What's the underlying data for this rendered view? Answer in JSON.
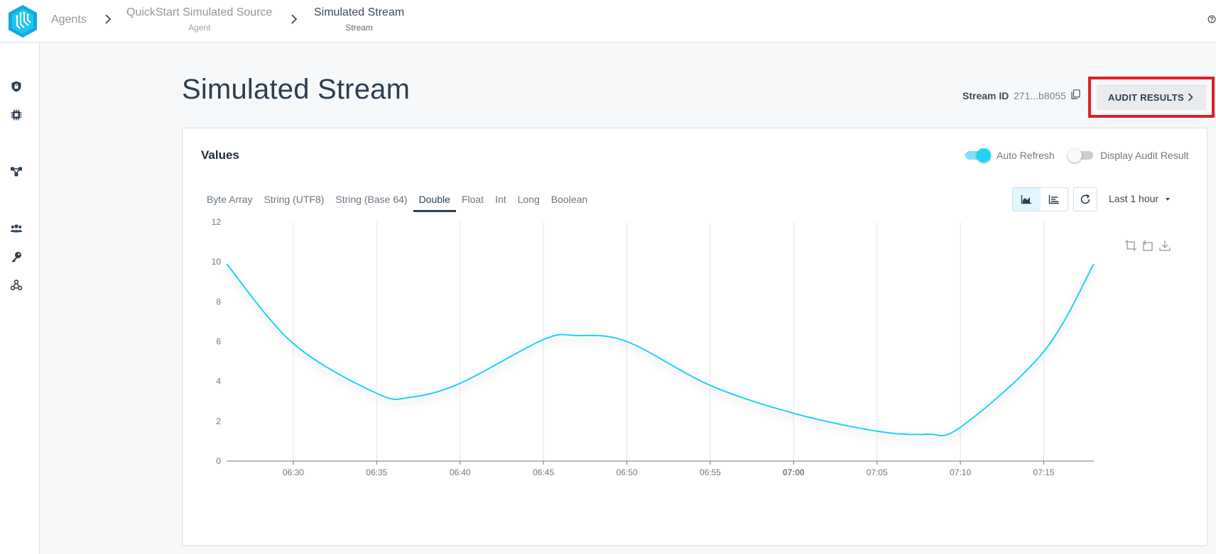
{
  "breadcrumbs": [
    {
      "label": "Agents",
      "sub": ""
    },
    {
      "label": "QuickStart Simulated Source",
      "sub": "Agent"
    },
    {
      "label": "Simulated Stream",
      "sub": "Stream"
    }
  ],
  "header": {
    "title": "Simulated Stream",
    "stream_id_label": "Stream ID",
    "stream_id_value": "271...b8055",
    "audit_button": "AUDIT RESULTS"
  },
  "sidebar": {
    "icons": [
      "shield-icon",
      "chip-icon",
      "network-icon",
      "users-icon",
      "key-icon",
      "webhook-icon"
    ]
  },
  "card": {
    "title": "Values",
    "auto_refresh_label": "Auto Refresh",
    "auto_refresh_on": true,
    "display_audit_label": "Display Audit Result",
    "display_audit_on": false,
    "tabs": [
      "Byte Array",
      "String (UTF8)",
      "String (Base 64)",
      "Double",
      "Float",
      "Int",
      "Long",
      "Boolean"
    ],
    "active_tab": "Double",
    "time_range": "Last 1 hour"
  },
  "colors": {
    "accent": "#1ed4f7",
    "title": "#2d3e50",
    "highlight_border": "#e01e26"
  },
  "chart_data": {
    "type": "line",
    "x": [
      "06:26",
      "06:30",
      "06:35",
      "06:37",
      "06:40",
      "06:45",
      "06:47",
      "06:50",
      "06:55",
      "07:00",
      "07:05",
      "07:08",
      "07:10",
      "07:15",
      "07:18"
    ],
    "series": [
      {
        "values": [
          9.9,
          5.9,
          3.4,
          3.2,
          3.9,
          6.1,
          6.3,
          6.0,
          3.8,
          2.4,
          1.5,
          1.35,
          1.7,
          5.5,
          9.9
        ]
      }
    ],
    "x_ticks": [
      "06:30",
      "06:35",
      "06:40",
      "06:45",
      "06:50",
      "06:55",
      "07:00",
      "07:05",
      "07:10",
      "07:15"
    ],
    "x_tick_bold": "07:00",
    "y_ticks": [
      0,
      2,
      4,
      6,
      8,
      10,
      12
    ],
    "ylim": [
      0,
      12
    ],
    "xlim": [
      "06:26",
      "07:18"
    ],
    "grid": "vertical",
    "color": "#1ed4f7"
  }
}
